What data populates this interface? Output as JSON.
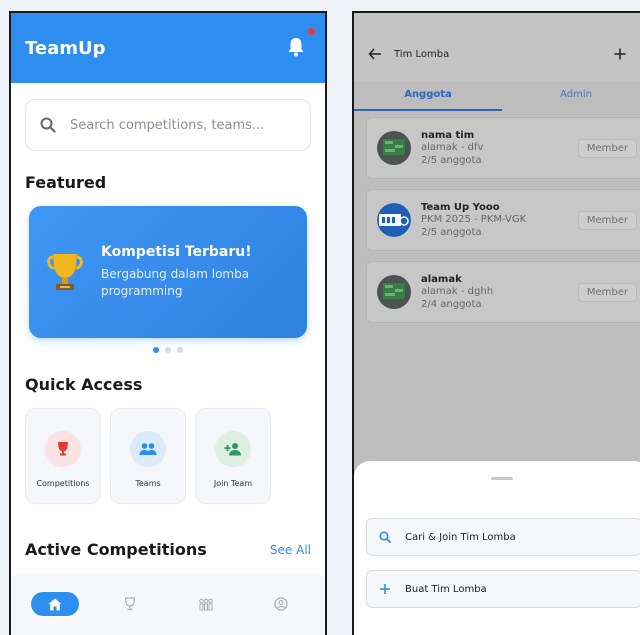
{
  "left": {
    "app_title": "TeamUp",
    "search": {
      "placeholder": "Search competitions, teams..."
    },
    "featured": {
      "title": "Featured",
      "banner_title": "Kompetisi Terbaru!",
      "banner_subtitle": "Bergabung dalam lomba programming",
      "slide_count": 3,
      "active_slide": 1
    },
    "quick_access": {
      "title": "Quick Access",
      "items": [
        {
          "label": "Competitions",
          "icon": "trophy-icon",
          "color": "#e53935",
          "bg": "#fbe3e3"
        },
        {
          "label": "Teams",
          "icon": "people-icon",
          "color": "#2e8ef0",
          "bg": "#dce9f9"
        },
        {
          "label": "Join Team",
          "icon": "add-person-icon",
          "color": "#2e9a5b",
          "bg": "#dcefe2"
        }
      ]
    },
    "active_competitions": {
      "title": "Active Competitions",
      "see_all": "See All"
    },
    "nav": [
      "home-icon",
      "trophy-icon",
      "people-icon",
      "profile-icon"
    ]
  },
  "right": {
    "title": "Tim Lomba",
    "tabs": [
      {
        "label": "Anggota",
        "active": true
      },
      {
        "label": "Admin",
        "active": false
      }
    ],
    "teams": [
      {
        "name": "nama tim",
        "sub": "alamak - dfv",
        "count": "2/5 anggota",
        "role": "Member"
      },
      {
        "name": "Team Up Yooo",
        "sub": "PKM 2025 - PKM-VGK",
        "count": "2/5 anggota",
        "role": "Member"
      },
      {
        "name": "alamak",
        "sub": "alamak - dghh",
        "count": "2/4 anggota",
        "role": "Member"
      }
    ],
    "sheet": {
      "join_label": "Cari & Join Tim Lomba",
      "create_label": "Buat Tim Lomba"
    }
  },
  "colors": {
    "primary": "#2e8ef0",
    "accent_dark": "#2a66b8"
  }
}
